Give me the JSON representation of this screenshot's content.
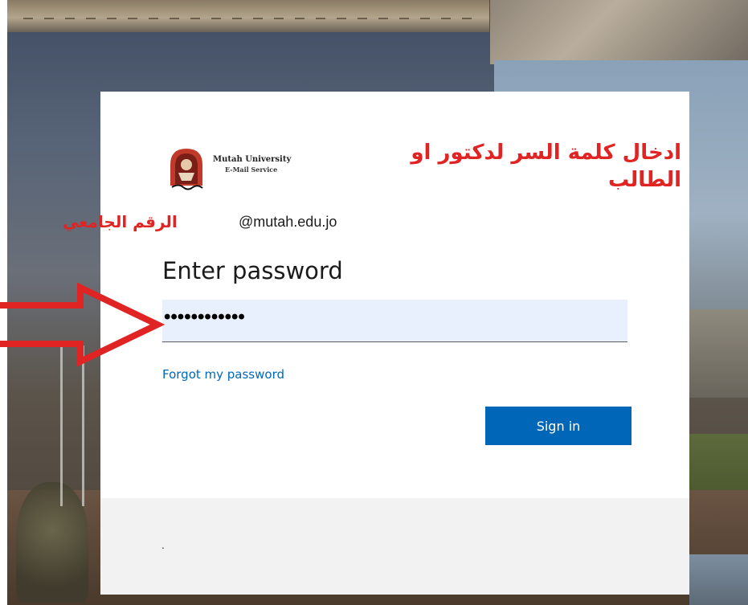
{
  "brand": {
    "name": "Mutah University",
    "subtitle": "E-Mail Service"
  },
  "identity": {
    "text": "@mutah.edu.jo"
  },
  "page": {
    "title": "Enter password"
  },
  "password": {
    "masked_value": "••••••••••••"
  },
  "links": {
    "forgot_password": "Forgot my password"
  },
  "buttons": {
    "sign_in": "Sign in"
  },
  "footer": {
    "text": "."
  },
  "annotations": {
    "instruction": "ادخال كلمة السر لدكتور او الطالب",
    "university_id": "الرقم الجامعي"
  },
  "colors": {
    "accent": "#0067b8",
    "annotation": "#e02424",
    "field_fill": "#e8f0fe"
  },
  "icons": {
    "logo": "university-logo-icon",
    "arrow": "red-arrow-icon"
  }
}
